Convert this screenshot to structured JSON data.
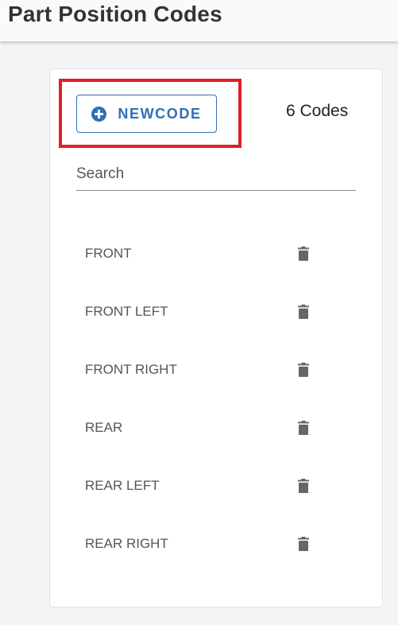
{
  "header": {
    "title": "Part Position Codes"
  },
  "toolbar": {
    "new_code_label": "NEWCODE",
    "count_text": "6 Codes"
  },
  "search": {
    "placeholder": "Search",
    "value": ""
  },
  "codes": [
    {
      "label": "FRONT"
    },
    {
      "label": "FRONT LEFT"
    },
    {
      "label": "FRONT RIGHT"
    },
    {
      "label": "REAR"
    },
    {
      "label": "REAR LEFT"
    },
    {
      "label": "REAR RIGHT"
    }
  ],
  "icons": {
    "add": "plus-circle-icon",
    "delete": "trash-icon"
  },
  "colors": {
    "accent": "#2f6fb5",
    "highlight": "#e02025",
    "icon": "#666666"
  }
}
